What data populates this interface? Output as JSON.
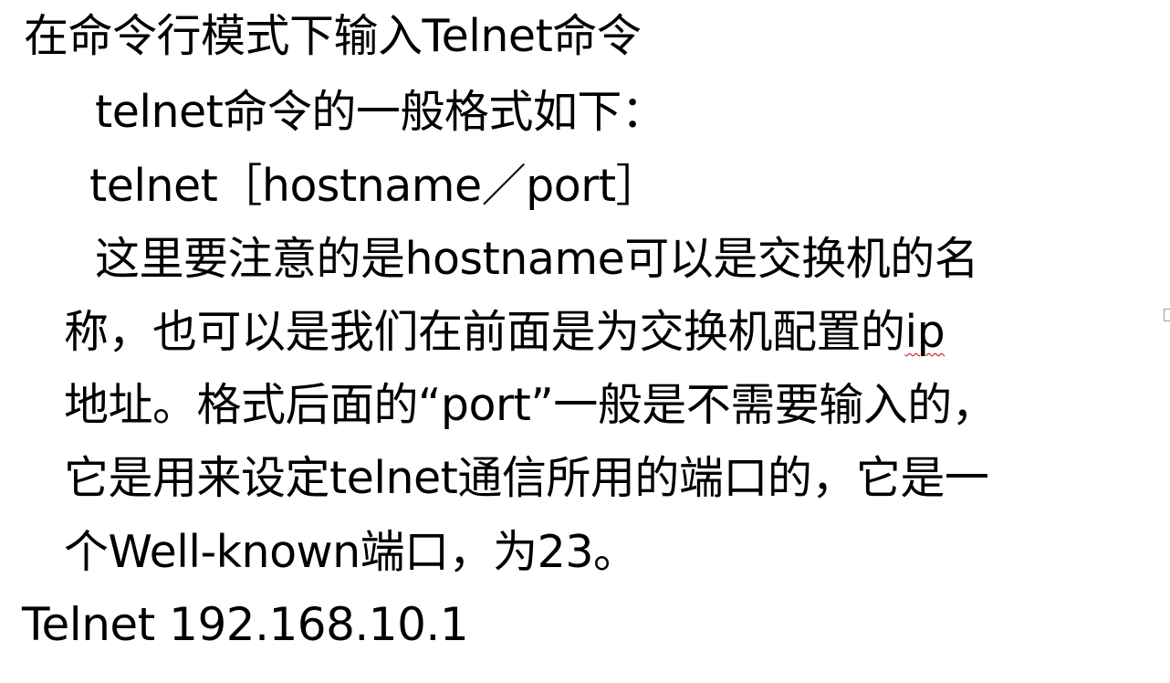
{
  "document": {
    "line1": "在命令行模式下输入Telnet命令",
    "line2": "telnet命令的一般格式如下：",
    "line3": "telnet［hostname／port］",
    "line4": "这里要注意的是hostname可以是交换机的名",
    "line5_before": "称，也可以是我们在前面是为交换机配置的",
    "line5_ip": "ip",
    "line6": "地址。格式后面的“port”一般是不需要输入的，",
    "line7": "它是用来设定telnet通信所用的端口的，它是一",
    "line8": "个Well-known端口，为23。",
    "line9": "Telnet 192.168.10.1"
  },
  "colors": {
    "text": "#000000",
    "spellcheck": "#c00000",
    "background": "#ffffff"
  }
}
